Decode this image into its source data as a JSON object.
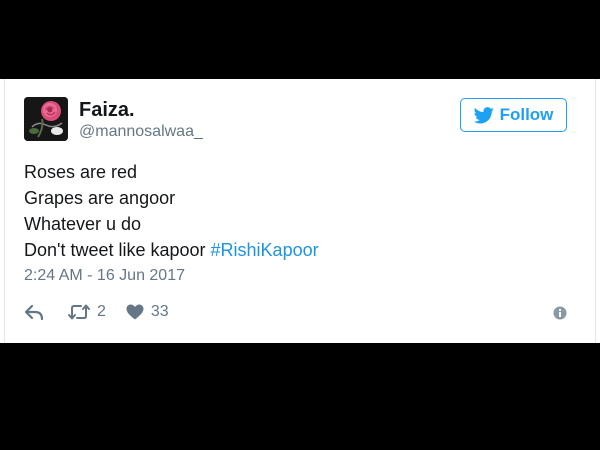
{
  "tweet": {
    "author": {
      "display_name": "Faiza.",
      "handle": "@mannosalwaa_",
      "avatar_icon": "rose-avatar"
    },
    "follow_button": {
      "label": "Follow",
      "icon": "twitter-bird-icon"
    },
    "text_lines": [
      "Roses are red",
      "Grapes are angoor",
      "Whatever u do",
      "Don't tweet like kapoor "
    ],
    "hashtag": "#RishiKapoor",
    "timestamp": "2:24 AM - 16 Jun 2017",
    "actions": {
      "reply_icon": "reply-icon",
      "retweet_icon": "retweet-icon",
      "retweet_count": "2",
      "like_icon": "heart-icon",
      "like_count": "33",
      "info_icon": "info-icon"
    }
  },
  "colors": {
    "accent": "#1da1f2",
    "hashtag": "#1b95e0",
    "text": "#14171a",
    "secondary": "#657786",
    "background": "#000000"
  }
}
